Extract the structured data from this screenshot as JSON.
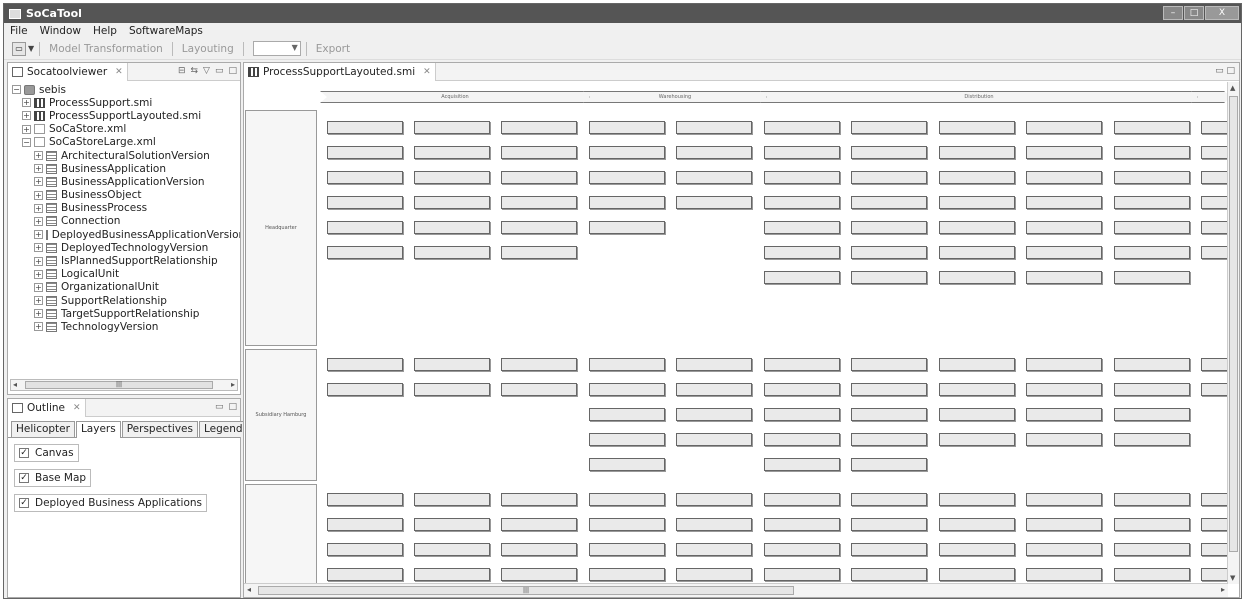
{
  "window": {
    "title": "SoCaTool",
    "controls": [
      "–",
      "□",
      "X"
    ]
  },
  "menu": [
    "File",
    "Window",
    "Help",
    "SoftwareMaps"
  ],
  "toolbar": {
    "model_transformation": "Model Transformation",
    "layouting": "Layouting",
    "export": "Export"
  },
  "left_view": {
    "tab": "Socatoolviewer",
    "tree": [
      {
        "label": "sebis",
        "level": 0,
        "icon": "db",
        "exp": "−"
      },
      {
        "label": "ProcessSupport.smi",
        "level": 1,
        "icon": "grid",
        "exp": "+"
      },
      {
        "label": "ProcessSupportLayouted.smi",
        "level": 1,
        "icon": "grid",
        "exp": "+"
      },
      {
        "label": "SoCaStore.xml",
        "level": 1,
        "icon": "file",
        "exp": "+"
      },
      {
        "label": "SoCaStoreLarge.xml",
        "level": 1,
        "icon": "file",
        "exp": "−"
      },
      {
        "label": "ArchitecturalSolutionVersion",
        "level": 2,
        "icon": "table",
        "exp": "+"
      },
      {
        "label": "BusinessApplication",
        "level": 2,
        "icon": "table",
        "exp": "+"
      },
      {
        "label": "BusinessApplicationVersion",
        "level": 2,
        "icon": "table",
        "exp": "+"
      },
      {
        "label": "BusinessObject",
        "level": 2,
        "icon": "table",
        "exp": "+"
      },
      {
        "label": "BusinessProcess",
        "level": 2,
        "icon": "table",
        "exp": "+"
      },
      {
        "label": "Connection",
        "level": 2,
        "icon": "table",
        "exp": "+"
      },
      {
        "label": "DeployedBusinessApplicationVersion",
        "level": 2,
        "icon": "table",
        "exp": "+"
      },
      {
        "label": "DeployedTechnologyVersion",
        "level": 2,
        "icon": "table",
        "exp": "+"
      },
      {
        "label": "IsPlannedSupportRelationship",
        "level": 2,
        "icon": "table",
        "exp": "+"
      },
      {
        "label": "LogicalUnit",
        "level": 2,
        "icon": "table",
        "exp": "+"
      },
      {
        "label": "OrganizationalUnit",
        "level": 2,
        "icon": "table",
        "exp": "+"
      },
      {
        "label": "SupportRelationship",
        "level": 2,
        "icon": "table",
        "exp": "+"
      },
      {
        "label": "TargetSupportRelationship",
        "level": 2,
        "icon": "table",
        "exp": "+"
      },
      {
        "label": "TechnologyVersion",
        "level": 2,
        "icon": "table",
        "exp": "+"
      }
    ]
  },
  "outline": {
    "tab": "Outline",
    "tabs": [
      "Helicopter",
      "Layers",
      "Perspectives",
      "Legend"
    ],
    "active_tab": "Layers",
    "layers": [
      {
        "label": "Canvas",
        "checked": true
      },
      {
        "label": "Base Map",
        "checked": true
      },
      {
        "label": "Deployed Business Applications",
        "checked": true
      }
    ]
  },
  "editor": {
    "tab": "ProcessSupportLayouted.smi",
    "processes": [
      "Acquisition",
      "Warehousing",
      "Distribution"
    ],
    "org_units": [
      "Headquarter",
      "",
      "Subsidiary Hamburg"
    ]
  }
}
